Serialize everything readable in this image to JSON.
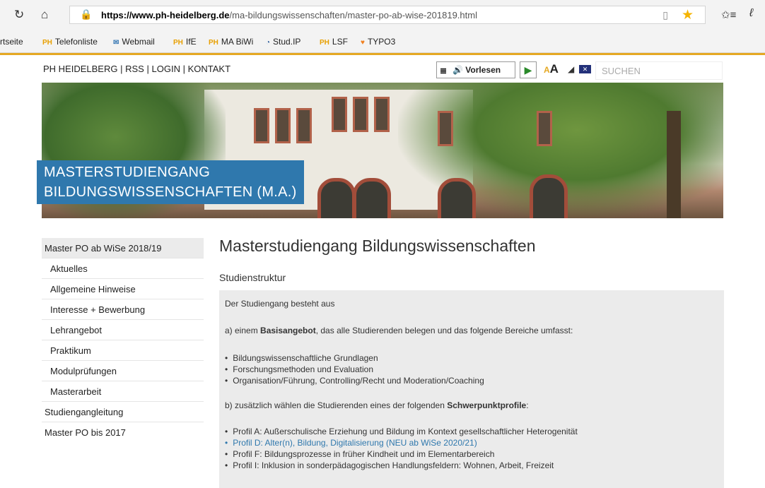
{
  "browser": {
    "nav_icons": [
      "reload-icon",
      "home-icon"
    ],
    "url_host": "https://www.ph-heidelberg.de",
    "url_path": "/ma-bildungswissenschaften/master-po-ab-wise-201819.html",
    "favorites": [
      "rtseite",
      "Telefonliste",
      "Webmail",
      "IfE",
      "MA BiWi",
      "Stud.IP",
      "LSF",
      "TYPO3"
    ]
  },
  "site_header": {
    "links": [
      "PH HEIDELBERG",
      "RSS",
      "LOGIN",
      "KONTAKT"
    ],
    "separator": "|",
    "vorlesen_label": "Vorlesen",
    "font_size_label": "A",
    "search_placeholder": "SUCHEN",
    "accent_color": "#e5a823"
  },
  "hero": {
    "title_line1": "MASTERSTUDIENGANG",
    "title_line2": "BILDUNGSWISSENSCHAFTEN (M.A.)",
    "title_bg": "#2f78ad"
  },
  "sidebar": {
    "items": [
      {
        "label": "Master PO ab WiSe 2018/19"
      },
      {
        "label": "Aktuelles"
      },
      {
        "label": "Allgemeine Hinweise"
      },
      {
        "label": "Interesse + Bewerbung"
      },
      {
        "label": "Lehrangebot"
      },
      {
        "label": "Praktikum"
      },
      {
        "label": "Modulprüfungen"
      },
      {
        "label": "Masterarbeit"
      },
      {
        "label": "Studiengangleitung"
      },
      {
        "label": "Master PO bis 2017"
      }
    ]
  },
  "main": {
    "title": "Masterstudiengang Bildungswissenschaften",
    "subtitle": "Studienstruktur",
    "intro": "Der Studiengang besteht aus",
    "basis_pre": "a) einem ",
    "basis_bold": "Basisangebot",
    "basis_post": ", das alle Studierenden belegen und das folgende Bereiche umfasst:",
    "basis_items": [
      "Bildungswissenschaftliche Grundlagen",
      "Forschungsmethoden und Evaluation",
      "Organisation/Führung, Controlling/Recht und Moderation/Coaching"
    ],
    "profile_pre": "b) zusätzlich wählen die Studierenden eines der folgenden ",
    "profile_bold": "Schwerpunktprofile",
    "profile_post": ":",
    "profiles": [
      "Profil A: Außerschulische Erziehung und Bildung im Kontext gesellschaftlicher Heterogenität",
      "Profil D: Alter(n), Bildung, Digitalisierung (NEU ab WiSe 2020/21)",
      "Profil F: Bildungsprozesse in früher Kindheit und im Elementarbereich",
      "Profil I: Inklusion in sonderpädagogischen Handlungsfeldern: Wohnen, Arbeit, Freizeit"
    ],
    "link_color": "#2f78ad"
  }
}
